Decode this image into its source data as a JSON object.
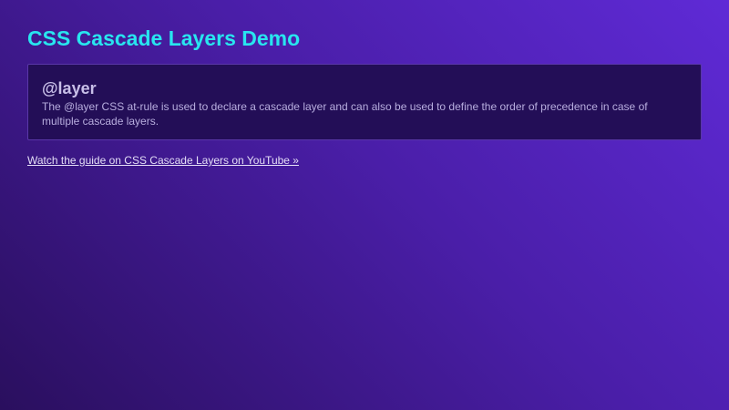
{
  "header": {
    "title": "CSS Cascade Layers Demo"
  },
  "card": {
    "heading": "@layer",
    "description": "The @layer CSS at-rule is used to declare a cascade layer and can also be used to define the order of precedence in case of multiple cascade layers."
  },
  "link": {
    "label": "Watch the guide on CSS Cascade Layers on YouTube »"
  },
  "colors": {
    "title": "#28e6ef",
    "card_background": "#230e57",
    "background_light": "#5f2ad6",
    "background_dark": "#2a0f5e"
  }
}
